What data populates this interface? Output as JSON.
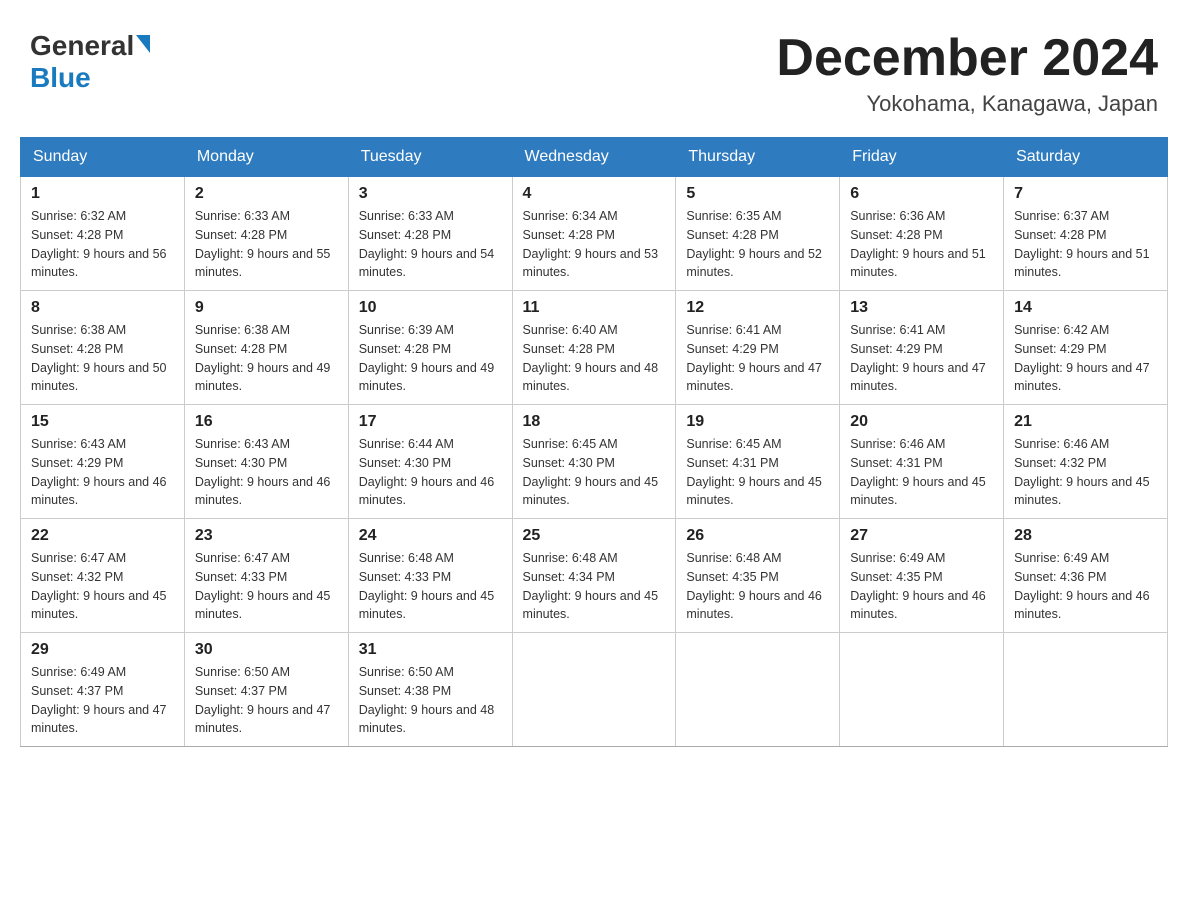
{
  "header": {
    "logo": {
      "general": "General",
      "blue": "Blue"
    },
    "title": "December 2024",
    "location": "Yokohama, Kanagawa, Japan"
  },
  "calendar": {
    "days_of_week": [
      "Sunday",
      "Monday",
      "Tuesday",
      "Wednesday",
      "Thursday",
      "Friday",
      "Saturday"
    ],
    "weeks": [
      [
        {
          "day": "1",
          "sunrise": "6:32 AM",
          "sunset": "4:28 PM",
          "daylight": "9 hours and 56 minutes."
        },
        {
          "day": "2",
          "sunrise": "6:33 AM",
          "sunset": "4:28 PM",
          "daylight": "9 hours and 55 minutes."
        },
        {
          "day": "3",
          "sunrise": "6:33 AM",
          "sunset": "4:28 PM",
          "daylight": "9 hours and 54 minutes."
        },
        {
          "day": "4",
          "sunrise": "6:34 AM",
          "sunset": "4:28 PM",
          "daylight": "9 hours and 53 minutes."
        },
        {
          "day": "5",
          "sunrise": "6:35 AM",
          "sunset": "4:28 PM",
          "daylight": "9 hours and 52 minutes."
        },
        {
          "day": "6",
          "sunrise": "6:36 AM",
          "sunset": "4:28 PM",
          "daylight": "9 hours and 51 minutes."
        },
        {
          "day": "7",
          "sunrise": "6:37 AM",
          "sunset": "4:28 PM",
          "daylight": "9 hours and 51 minutes."
        }
      ],
      [
        {
          "day": "8",
          "sunrise": "6:38 AM",
          "sunset": "4:28 PM",
          "daylight": "9 hours and 50 minutes."
        },
        {
          "day": "9",
          "sunrise": "6:38 AM",
          "sunset": "4:28 PM",
          "daylight": "9 hours and 49 minutes."
        },
        {
          "day": "10",
          "sunrise": "6:39 AM",
          "sunset": "4:28 PM",
          "daylight": "9 hours and 49 minutes."
        },
        {
          "day": "11",
          "sunrise": "6:40 AM",
          "sunset": "4:28 PM",
          "daylight": "9 hours and 48 minutes."
        },
        {
          "day": "12",
          "sunrise": "6:41 AM",
          "sunset": "4:29 PM",
          "daylight": "9 hours and 47 minutes."
        },
        {
          "day": "13",
          "sunrise": "6:41 AM",
          "sunset": "4:29 PM",
          "daylight": "9 hours and 47 minutes."
        },
        {
          "day": "14",
          "sunrise": "6:42 AM",
          "sunset": "4:29 PM",
          "daylight": "9 hours and 47 minutes."
        }
      ],
      [
        {
          "day": "15",
          "sunrise": "6:43 AM",
          "sunset": "4:29 PM",
          "daylight": "9 hours and 46 minutes."
        },
        {
          "day": "16",
          "sunrise": "6:43 AM",
          "sunset": "4:30 PM",
          "daylight": "9 hours and 46 minutes."
        },
        {
          "day": "17",
          "sunrise": "6:44 AM",
          "sunset": "4:30 PM",
          "daylight": "9 hours and 46 minutes."
        },
        {
          "day": "18",
          "sunrise": "6:45 AM",
          "sunset": "4:30 PM",
          "daylight": "9 hours and 45 minutes."
        },
        {
          "day": "19",
          "sunrise": "6:45 AM",
          "sunset": "4:31 PM",
          "daylight": "9 hours and 45 minutes."
        },
        {
          "day": "20",
          "sunrise": "6:46 AM",
          "sunset": "4:31 PM",
          "daylight": "9 hours and 45 minutes."
        },
        {
          "day": "21",
          "sunrise": "6:46 AM",
          "sunset": "4:32 PM",
          "daylight": "9 hours and 45 minutes."
        }
      ],
      [
        {
          "day": "22",
          "sunrise": "6:47 AM",
          "sunset": "4:32 PM",
          "daylight": "9 hours and 45 minutes."
        },
        {
          "day": "23",
          "sunrise": "6:47 AM",
          "sunset": "4:33 PM",
          "daylight": "9 hours and 45 minutes."
        },
        {
          "day": "24",
          "sunrise": "6:48 AM",
          "sunset": "4:33 PM",
          "daylight": "9 hours and 45 minutes."
        },
        {
          "day": "25",
          "sunrise": "6:48 AM",
          "sunset": "4:34 PM",
          "daylight": "9 hours and 45 minutes."
        },
        {
          "day": "26",
          "sunrise": "6:48 AM",
          "sunset": "4:35 PM",
          "daylight": "9 hours and 46 minutes."
        },
        {
          "day": "27",
          "sunrise": "6:49 AM",
          "sunset": "4:35 PM",
          "daylight": "9 hours and 46 minutes."
        },
        {
          "day": "28",
          "sunrise": "6:49 AM",
          "sunset": "4:36 PM",
          "daylight": "9 hours and 46 minutes."
        }
      ],
      [
        {
          "day": "29",
          "sunrise": "6:49 AM",
          "sunset": "4:37 PM",
          "daylight": "9 hours and 47 minutes."
        },
        {
          "day": "30",
          "sunrise": "6:50 AM",
          "sunset": "4:37 PM",
          "daylight": "9 hours and 47 minutes."
        },
        {
          "day": "31",
          "sunrise": "6:50 AM",
          "sunset": "4:38 PM",
          "daylight": "9 hours and 48 minutes."
        },
        null,
        null,
        null,
        null
      ]
    ]
  }
}
